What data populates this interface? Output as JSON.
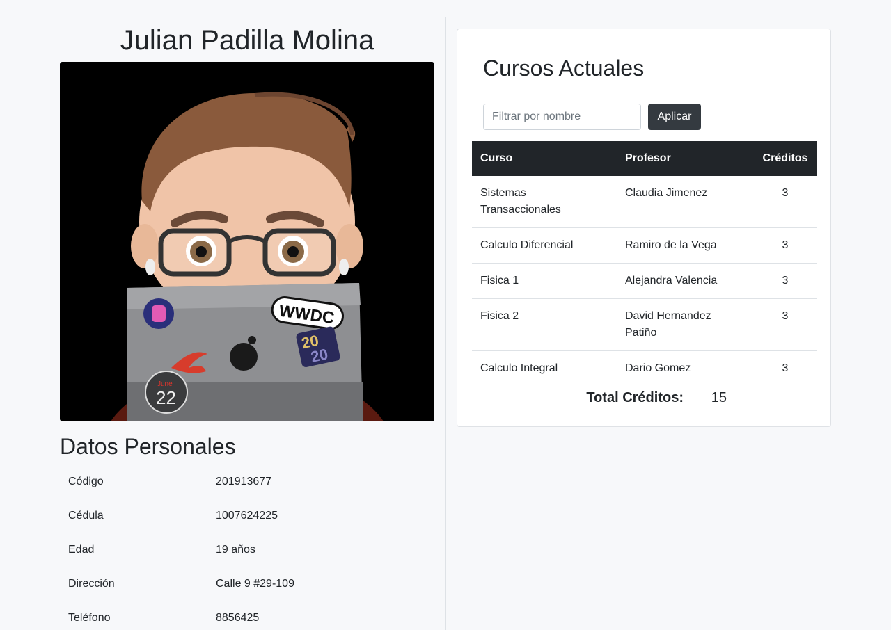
{
  "profile": {
    "name": "Julian Padilla Molina",
    "photo_stickers": {
      "wwdc": "WWDC",
      "year_top": "20",
      "year_bottom": "20",
      "june": "June",
      "day": "22"
    }
  },
  "personal": {
    "title": "Datos Personales",
    "rows": [
      {
        "label": "Código",
        "value": "201913677"
      },
      {
        "label": "Cédula",
        "value": "1007624225"
      },
      {
        "label": "Edad",
        "value": "19 años"
      },
      {
        "label": "Dirección",
        "value": "Calle 9 #29-109"
      },
      {
        "label": "Teléfono",
        "value": "8856425"
      }
    ]
  },
  "courses": {
    "title": "Cursos Actuales",
    "filter_placeholder": "Filtrar por nombre",
    "apply_label": "Aplicar",
    "headers": {
      "course": "Curso",
      "professor": "Profesor",
      "credits": "Créditos"
    },
    "rows": [
      {
        "course": "Sistemas Transaccionales",
        "professor": "Claudia Jimenez",
        "credits": "3"
      },
      {
        "course": "Calculo Diferencial",
        "professor": "Ramiro de la Vega",
        "credits": "3"
      },
      {
        "course": "Fisica 1",
        "professor": "Alejandra Valencia",
        "credits": "3"
      },
      {
        "course": "Fisica 2",
        "professor": "David Hernandez Patiño",
        "credits": "3"
      },
      {
        "course": "Calculo Integral",
        "professor": "Dario Gomez",
        "credits": "3"
      }
    ],
    "total_label": "Total Créditos:",
    "total_value": "15"
  },
  "colors": {
    "page_bg": "#f7f8fa",
    "table_header_bg": "#212529",
    "button_bg": "#343a40",
    "border": "#dee2e6"
  }
}
